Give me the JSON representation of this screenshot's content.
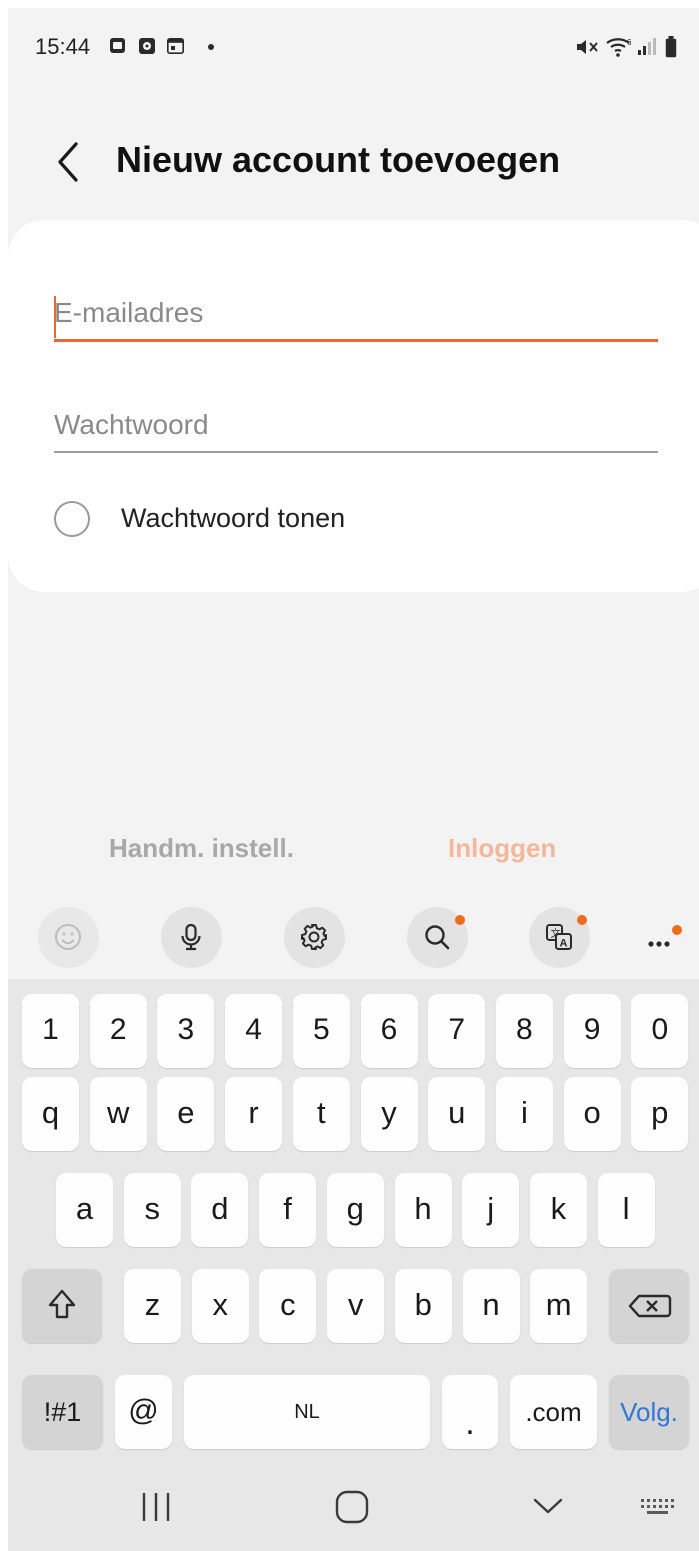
{
  "status_bar": {
    "time": "15:44",
    "icons": [
      "gallery-icon",
      "clock-app-icon",
      "calendar-icon",
      "notification-dot",
      "mute-icon",
      "wifi-icon",
      "signal-icon",
      "battery-icon"
    ]
  },
  "header": {
    "title": "Nieuw account toevoegen",
    "back_icon": "chevron-left-icon"
  },
  "form": {
    "email_placeholder": "E-mailadres",
    "email_value": "",
    "password_placeholder": "Wachtwoord",
    "password_value": "",
    "show_password_label": "Wachtwoord tonen",
    "show_password_checked": false
  },
  "actions": {
    "manual_setup": "Handm. instell.",
    "login": "Inloggen"
  },
  "keyboard_toolbar": {
    "icons": [
      "emoji-icon",
      "microphone-icon",
      "settings-icon",
      "search-icon",
      "translate-icon",
      "more-icon"
    ]
  },
  "keyboard": {
    "row_numbers": [
      "1",
      "2",
      "3",
      "4",
      "5",
      "6",
      "7",
      "8",
      "9",
      "0"
    ],
    "row_top": [
      "q",
      "w",
      "e",
      "r",
      "t",
      "y",
      "u",
      "i",
      "o",
      "p"
    ],
    "row_middle": [
      "a",
      "s",
      "d",
      "f",
      "g",
      "h",
      "j",
      "k",
      "l"
    ],
    "row_bottom": [
      "z",
      "x",
      "c",
      "v",
      "b",
      "n",
      "m"
    ],
    "symbols_key": "!#1",
    "at_key": "@",
    "space_key": "NL",
    "period_key": ".",
    "com_key": ".com",
    "next_key": "Volg."
  },
  "nav_bar": {
    "icons": [
      "recent-apps-icon",
      "home-icon",
      "hide-keyboard-icon",
      "keyboard-switch-icon"
    ]
  },
  "colors": {
    "accent": "#e26a37",
    "badge": "#ef6c1a",
    "volg": "#2f78d6",
    "login_disabled": "#f4b79a",
    "manual_disabled": "#a8a8a8"
  }
}
